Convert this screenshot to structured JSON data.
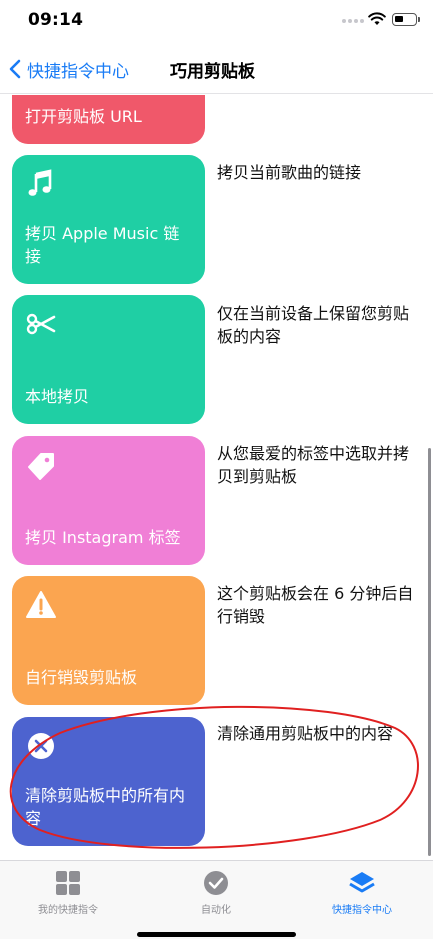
{
  "status_bar": {
    "time": "09:14"
  },
  "nav": {
    "back_label": "快捷指令中心",
    "title": "巧用剪贴板"
  },
  "cards": [
    {
      "title": "打开剪贴板 URL",
      "description": "",
      "color": "#f0586a",
      "icon": ""
    },
    {
      "title": "拷贝 Apple Music 链接",
      "description": "拷贝当前歌曲的链接",
      "color": "#1fcfa4",
      "icon": "music-note-icon"
    },
    {
      "title": "本地拷贝",
      "description": "仅在当前设备上保留您剪贴板的内容",
      "color": "#1fcfa4",
      "icon": "scissors-icon"
    },
    {
      "title": "拷贝 Instagram 标签",
      "description": "从您最爱的标签中选取并拷贝到剪贴板",
      "color": "#f07fd6",
      "icon": "tag-icon"
    },
    {
      "title": "自行销毁剪贴板",
      "description": "这个剪贴板会在 6 分钟后自行销毁",
      "color": "#fba550",
      "icon": "warning-icon"
    },
    {
      "title": "清除剪贴板中的所有内容",
      "description": "清除通用剪贴板中的内容",
      "color": "#4d63cf",
      "icon": "clear-icon"
    }
  ],
  "tabs": [
    {
      "label": "我的快捷指令",
      "icon": "grid-icon",
      "active": false
    },
    {
      "label": "自动化",
      "icon": "clock-check-icon",
      "active": false
    },
    {
      "label": "快捷指令中心",
      "icon": "layers-icon",
      "active": true
    }
  ],
  "colors": {
    "accent": "#1a7cf5",
    "annotation": "#e02020"
  }
}
